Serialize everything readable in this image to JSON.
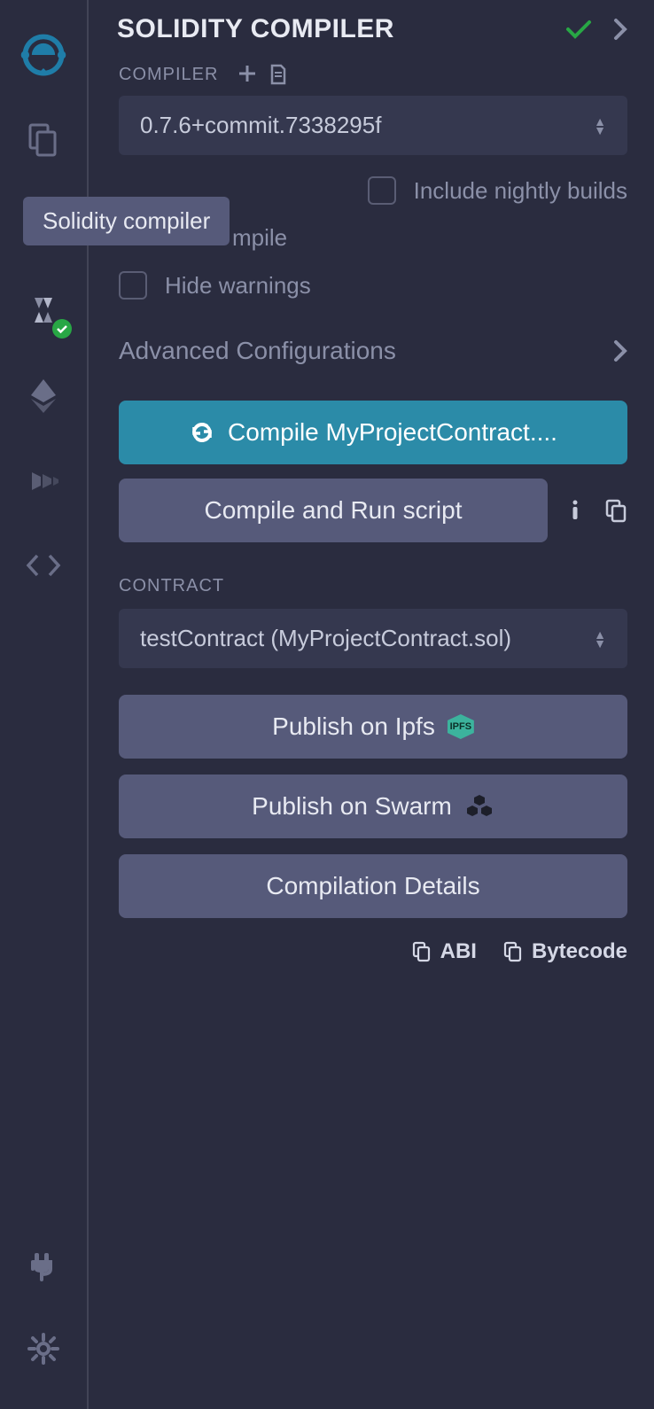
{
  "tooltip": "Solidity compiler",
  "title": "SOLIDITY COMPILER",
  "compilerLabel": "COMPILER",
  "compilerValue": "0.7.6+commit.7338295f",
  "checks": {
    "nightly": "Include nightly builds",
    "auto": "mpile",
    "hide": "Hide warnings"
  },
  "advanced": "Advanced Configurations",
  "compileBtn": "Compile MyProjectContract....",
  "compileRunBtn": "Compile and Run script",
  "contractLabel": "CONTRACT",
  "contractValue": "testContract (MyProjectContract.sol)",
  "publishIpfs": "Publish on Ipfs",
  "ipfsBadge": "IPFS",
  "publishSwarm": "Publish on Swarm",
  "details": "Compilation Details",
  "abi": "ABI",
  "bytecode": "Bytecode"
}
